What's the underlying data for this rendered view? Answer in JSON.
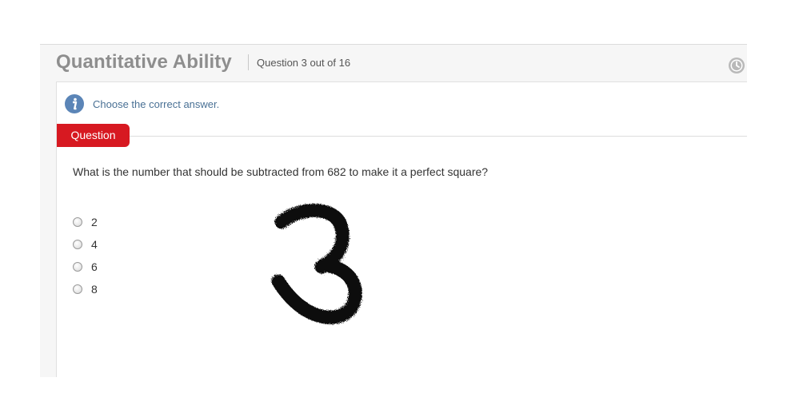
{
  "header": {
    "title": "Quantitative Ability",
    "question_counter": "Question 3 out of 16",
    "timer_icon": "clock-icon"
  },
  "instruction": {
    "icon": "info-icon",
    "text": "Choose the correct answer."
  },
  "question_tab": {
    "label": "Question"
  },
  "question": {
    "text": "What is the number that should be subtracted from 682 to make it a perfect square?",
    "options": [
      {
        "label": "2",
        "selected": false
      },
      {
        "label": "4",
        "selected": false
      },
      {
        "label": "6",
        "selected": false
      },
      {
        "label": "8",
        "selected": false
      }
    ]
  },
  "handwritten_mark": "3",
  "colors": {
    "tab_red": "#d71921",
    "info_blue": "#5b85b7",
    "title_gray": "#8e8e8e"
  }
}
